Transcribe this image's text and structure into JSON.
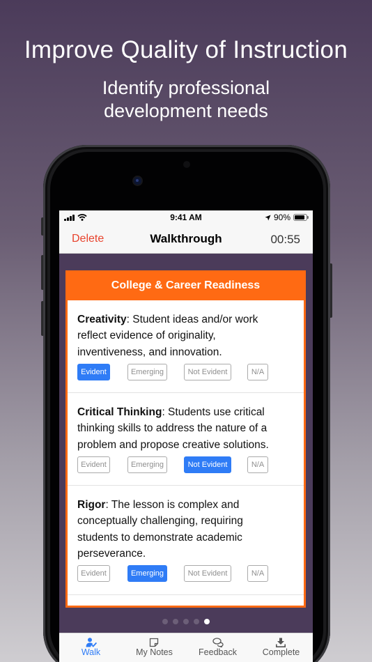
{
  "promo": {
    "headline": "Improve Quality of Instruction",
    "subline": "Identify professional development needs"
  },
  "status_bar": {
    "time": "9:41 AM",
    "battery": "90%",
    "battery_level": 0.9
  },
  "nav": {
    "delete_label": "Delete",
    "title": "Walkthrough",
    "timer": "00:55"
  },
  "card": {
    "title": "College & Career Readiness",
    "criteria": [
      {
        "name": "Creativity",
        "description": ":  Student ideas and/or work reflect evidence of originality, inventiveness, and innovation.",
        "selected": "Evident"
      },
      {
        "name": "Critical Thinking",
        "description": ":  Students use critical thinking skills to address the nature of a problem and propose creative solutions.",
        "selected": "Not Evident"
      },
      {
        "name": "Rigor",
        "description": ":  The lesson is complex and conceptually challenging, requiring students to demonstrate academic perseverance.",
        "selected": "Emerging"
      }
    ],
    "rating_options": [
      "Evident",
      "Emerging",
      "Not Evident",
      "N/A"
    ]
  },
  "pager": {
    "count": 5,
    "current": 5
  },
  "tabs": [
    {
      "label": "Walk",
      "icon": "walk-person-icon",
      "active": true
    },
    {
      "label": "My Notes",
      "icon": "note-icon",
      "active": false
    },
    {
      "label": "Feedback",
      "icon": "chat-bubbles-icon",
      "active": false
    },
    {
      "label": "Complete",
      "icon": "download-tray-icon",
      "active": false
    }
  ],
  "colors": {
    "accent": "#2f7cf6",
    "card_header": "#ff6a13",
    "delete": "#e8432d",
    "screen_bg": "#4b3b5a"
  }
}
